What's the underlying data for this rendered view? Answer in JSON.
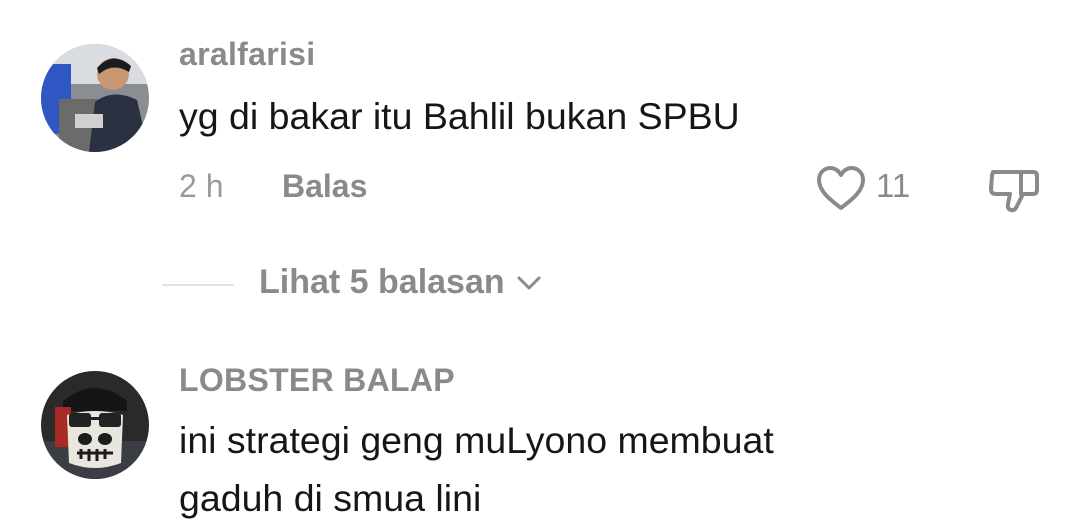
{
  "comments": [
    {
      "username": "aralfarisi",
      "text": "yg di bakar itu Bahlil bukan SPBU",
      "time": "2 h",
      "reply_label": "Balas",
      "likes": "11",
      "view_replies": "Lihat 5 balasan"
    },
    {
      "username": "LOBSTER BALAP",
      "text_line1": "ini strategi geng muLyono membuat",
      "text_line2": "gaduh di smua lini"
    }
  ],
  "icons": {
    "like": "heart-outline-icon",
    "dislike": "thumbs-down-icon",
    "expand": "chevron-down-icon"
  },
  "colors": {
    "username": "#8a8a8a",
    "text": "#161616",
    "meta": "#9a9a9a"
  }
}
